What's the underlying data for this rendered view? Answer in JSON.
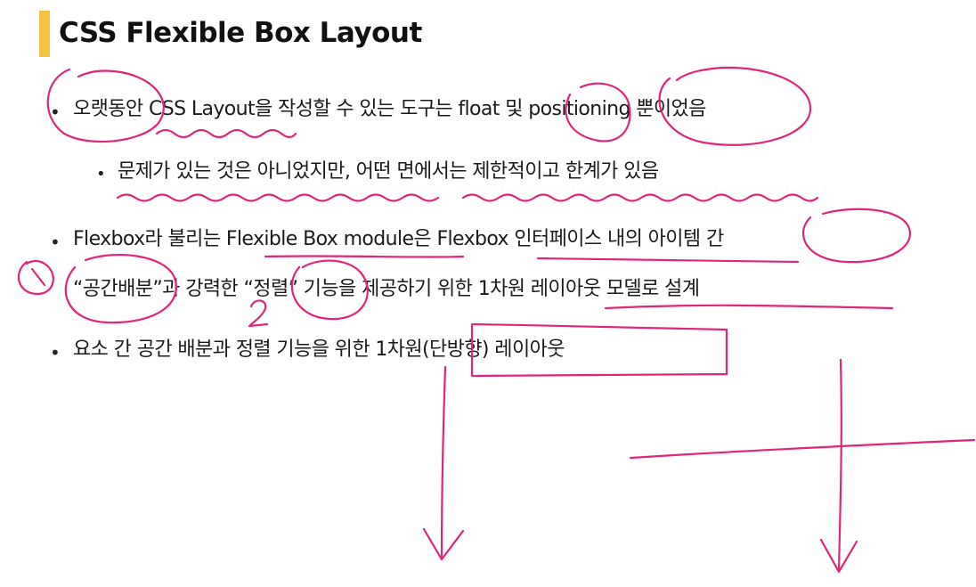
{
  "slide": {
    "title": "CSS Flexible Box Layout",
    "accent_color": "#f5c342",
    "annotation_color": "#e0257a",
    "bullets": [
      {
        "level": 1,
        "text": "오랫동안 CSS Layout을 작성할 수 있는 도구는 float 및 positioning 뿐이었음"
      },
      {
        "level": 2,
        "text": "문제가 있는 것은 아니었지만, 어떤 면에서는 제한적이고 한계가 있음"
      },
      {
        "level": 1,
        "text": "Flexbox라 불리는 Flexible Box module은 Flexbox 인터페이스 내의 아이템 간"
      },
      {
        "level": 1,
        "text": "“공간배분”과 강력한 “정렬” 기능을 제공하기 위한 1차원 레이아웃 모델로 설계",
        "continuation": true
      },
      {
        "level": 1,
        "text": "요소 간 공간 배분과 정렬 기능을 위한 1차원(단방향) 레이아웃"
      }
    ],
    "annotations": {
      "mark_1": "1",
      "mark_2": "2"
    }
  }
}
